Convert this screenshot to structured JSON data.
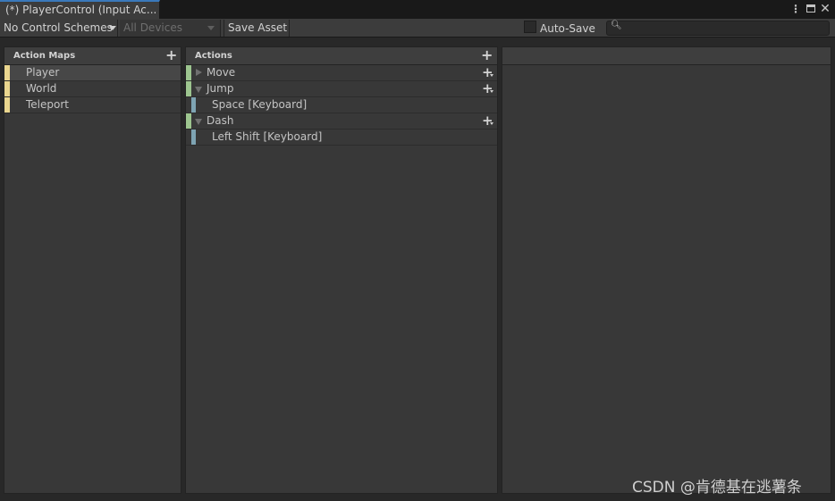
{
  "window": {
    "tab_title": "(*) PlayerControl (Input Ac...",
    "menu_icon": "kebab-menu-icon",
    "maximize_icon": "maximize-icon",
    "close_icon": "close-icon",
    "close_glyph": "✕"
  },
  "toolbar": {
    "control_schemes": "No Control Schemes",
    "devices": "All Devices",
    "save_label": "Save Asset",
    "autosave_label": "Auto-Save",
    "autosave_checked": false,
    "search_value": "",
    "search_icon": "search-icon"
  },
  "action_maps": {
    "header": "Action Maps",
    "items": [
      {
        "label": "Player",
        "selected": true
      },
      {
        "label": "World",
        "selected": false
      },
      {
        "label": "Teleport",
        "selected": false
      }
    ]
  },
  "actions": {
    "header": "Actions",
    "items": [
      {
        "type": "action",
        "label": "Move",
        "expanded": false
      },
      {
        "type": "action",
        "label": "Jump",
        "expanded": true
      },
      {
        "type": "binding",
        "label": "Space [Keyboard]"
      },
      {
        "type": "action",
        "label": "Dash",
        "expanded": true
      },
      {
        "type": "binding",
        "label": "Left Shift [Keyboard]"
      }
    ]
  },
  "colors": {
    "action_map_bar": "#ead68f",
    "action_bar": "#9dc58f",
    "binding_bar": "#7ea4b3",
    "tab_accent": "#3a79bb"
  },
  "watermark": "CSDN @肯德基在逃薯条"
}
